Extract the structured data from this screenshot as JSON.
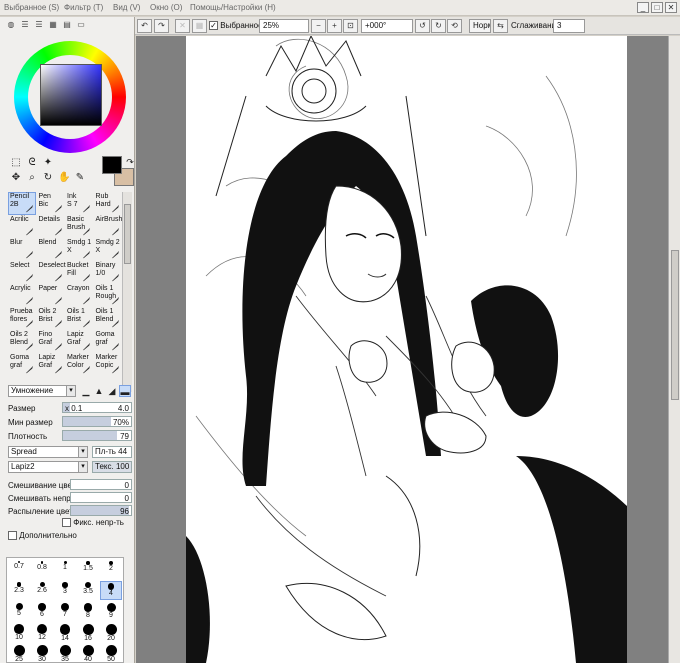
{
  "menu": {
    "items": [
      "Выбранное",
      "Фильтр",
      "Вид",
      "Окно",
      "Помощь/Настройки"
    ],
    "shortcuts": [
      "(S)",
      "(T)",
      "(V)",
      "(O)",
      "(H)"
    ]
  },
  "window_controls": {
    "minimize": "_",
    "maximize": "□",
    "close": "✕"
  },
  "toolbar": {
    "selection_label": "Выбранное",
    "zoom_value": "25%",
    "rotation_value": "+000°",
    "mode_value": "Норм",
    "smoothing_label": "Сглаживание",
    "smoothing_value": "3"
  },
  "colors": {
    "foreground": "#000000",
    "background": "#d8bfa4",
    "selected_brush": "#c8dcf8"
  },
  "brushes": [
    {
      "label": "Pencil\n2B",
      "selected": true
    },
    {
      "label": "Pen\nBic"
    },
    {
      "label": "Ink\nS 7"
    },
    {
      "label": "Rub\nHard"
    },
    {
      "label": "Acrilic"
    },
    {
      "label": "Details"
    },
    {
      "label": "Basic\nBrush"
    },
    {
      "label": "AirBrush"
    },
    {
      "label": "Blur"
    },
    {
      "label": "Blend"
    },
    {
      "label": "Smdg 1\nX"
    },
    {
      "label": "Smdg 2\nX"
    },
    {
      "label": "Select"
    },
    {
      "label": "Deselect"
    },
    {
      "label": "Bucket\nFill"
    },
    {
      "label": "Binary\n1/0"
    },
    {
      "label": "Acrylic"
    },
    {
      "label": "Paper"
    },
    {
      "label": "Crayon"
    },
    {
      "label": "Oils 1\nRough"
    },
    {
      "label": "Prueba\nflores"
    },
    {
      "label": "Oils 2\nBrist"
    },
    {
      "label": "Oils 1\nBrist"
    },
    {
      "label": "Oils 1\nBlend"
    },
    {
      "label": "Oils 2\nBlend"
    },
    {
      "label": "Fino\nGraf"
    },
    {
      "label": "Lapiz\nGraf"
    },
    {
      "label": "Goma\ngraf"
    },
    {
      "label": "Goma\ngraf"
    },
    {
      "label": "Lapiz\nGraf"
    },
    {
      "label": "Marker\nColor"
    },
    {
      "label": "Marker\nCopic"
    }
  ],
  "settings": {
    "blend_mode": "Умножение",
    "size_label": "Размер",
    "size_multiplier": "x 0.1",
    "size_value": "4.0",
    "size_level": 0.1,
    "min_size_label": "Мин размер",
    "min_size_value": "70%",
    "min_size_level": 0.7,
    "density_label": "Плотность",
    "density_value": "79",
    "density_level": 0.79,
    "shape_value": "Spread",
    "shape_strength_label": "Пл-ть",
    "shape_strength_value": "44",
    "texture_value": "Lapiz2",
    "texture_strength_label": "Текс.",
    "texture_strength_value": "100",
    "color_mix_label": "Смешивание цвет",
    "color_mix_value": "0",
    "opacity_mix_label": "Смешивать непрз",
    "opacity_mix_value": "0",
    "color_spread_label": "Распыление цвет",
    "color_spread_value": "96",
    "color_spread_level": 0.96,
    "fix_opacity_label": "Фикс. непр-ть",
    "advanced_label": "Дополнительно"
  },
  "brush_sizes": [
    "0.7",
    "0.8",
    "1",
    "1.5",
    "2",
    "2.3",
    "2.6",
    "3",
    "3.5",
    "4",
    "5",
    "6",
    "7",
    "8",
    "9",
    "10",
    "12",
    "14",
    "16",
    "20",
    "25",
    "30",
    "35",
    "40",
    "50"
  ],
  "selected_size": "4",
  "canvas": {
    "zoom": "25%"
  }
}
